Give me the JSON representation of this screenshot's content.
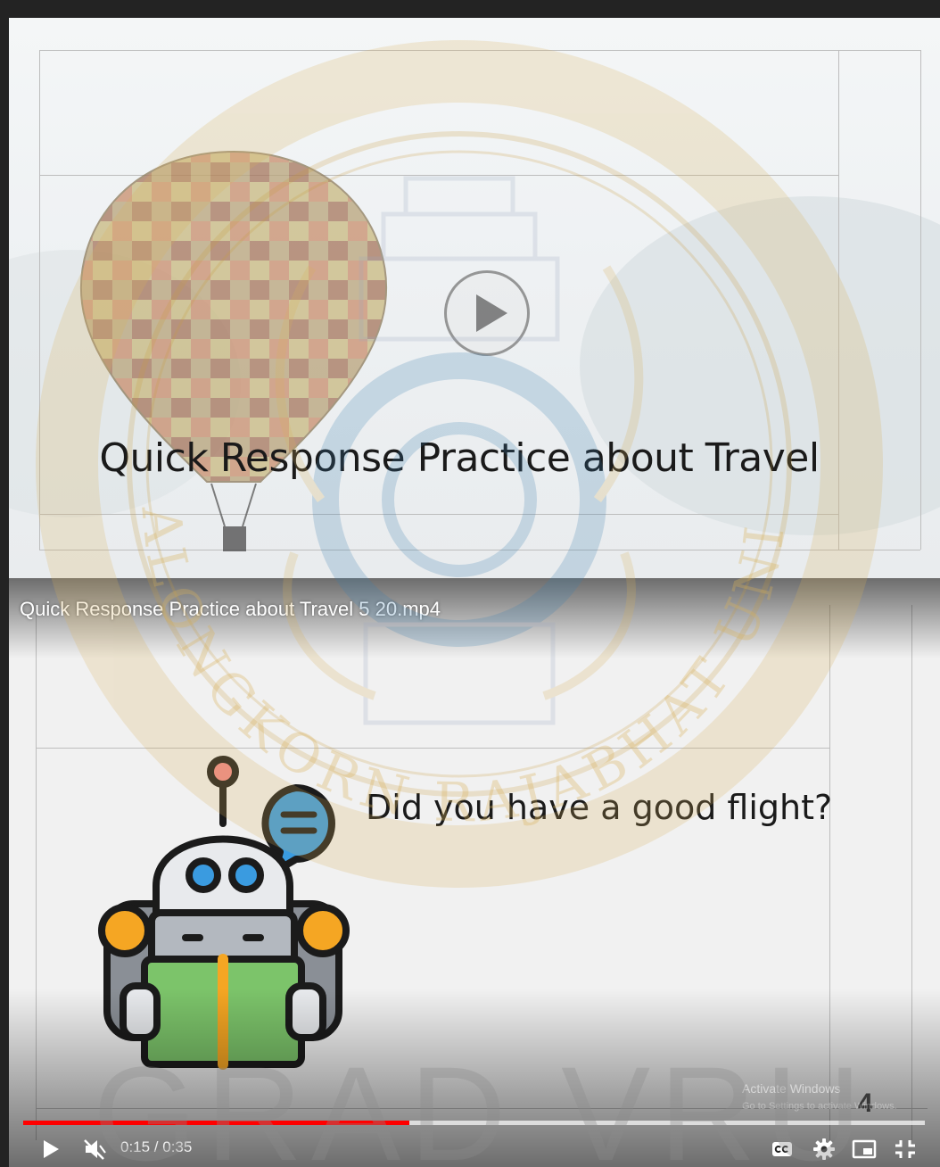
{
  "top_video": {
    "slide_title": "Quick Response Practice about Travel"
  },
  "bottom_video": {
    "title": "Quick Response Practice about Travel 5 20.mp4",
    "slide_question": "Did you have a good flight?",
    "slide_number": "4",
    "activate_windows": "Activate Windows",
    "activate_windows_sub": "Go to Settings to activate Windows.",
    "time_display": "0:15 / 0:35",
    "progress": {
      "played_fraction": 0.4286,
      "loaded_fraction": 1.0
    },
    "controls": {
      "play": "play-icon",
      "mute": "volume-muted-icon",
      "captions": "captions-icon",
      "settings": "gear-icon",
      "miniplayer": "miniplayer-icon",
      "exit_fullscreen": "exit-fullscreen-icon"
    }
  },
  "watermark": {
    "text": "GRAD VRU",
    "seal_text": "VALAYA ALONGKORN RAJABHAT UNIVERSITY"
  },
  "colors": {
    "progress_played": "#ff0000",
    "seal_gold": "#d9b25a",
    "robot_green": "#7cc46a",
    "robot_orange": "#f5a623",
    "robot_blue": "#3a9be0"
  }
}
